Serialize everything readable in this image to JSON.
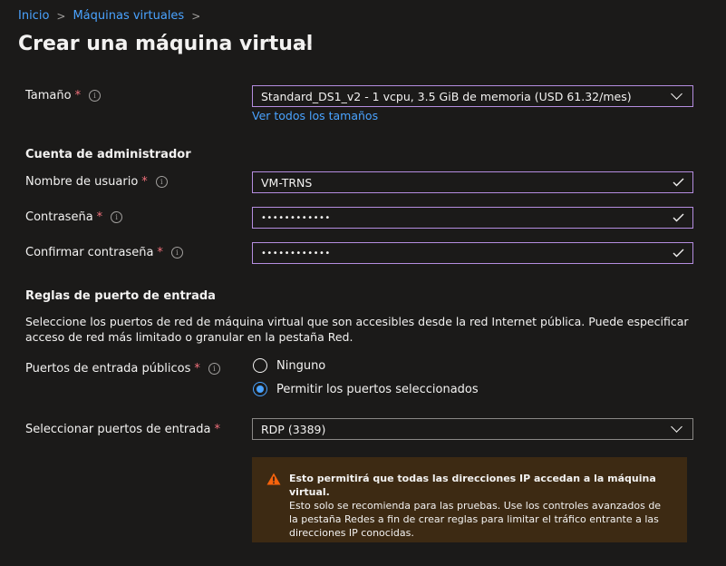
{
  "breadcrumb": {
    "items": [
      "Inicio",
      "Máquinas virtuales"
    ],
    "separator": ">"
  },
  "page": {
    "title": "Crear una máquina virtual",
    "more": "···"
  },
  "size": {
    "label": "Tamaño",
    "required": "*",
    "value": "Standard_DS1_v2 - 1 vcpu, 3.5 GiB de memoria (USD 61.32/mes)",
    "link": "Ver todos los tamaños"
  },
  "admin": {
    "heading": "Cuenta de administrador",
    "username_label": "Nombre de usuario",
    "username_value": "VM-TRNS",
    "password_label": "Contraseña",
    "password_value": "••••••••••••",
    "confirm_label": "Confirmar contraseña",
    "confirm_value": "••••••••••••",
    "required": "*"
  },
  "ports": {
    "heading": "Reglas de puerto de entrada",
    "description": "Seleccione los puertos de red de máquina virtual que son accesibles desde la red Internet pública. Puede especificar acceso de red más limitado o granular en la pestaña Red.",
    "public_label": "Puertos de entrada públicos",
    "options": [
      "Ninguno",
      "Permitir los puertos seleccionados"
    ],
    "selected_option": "Permitir los puertos seleccionados",
    "select_label": "Seleccionar puertos de entrada",
    "select_value": "RDP (3389)",
    "required": "*"
  },
  "warning": {
    "title": "Esto permitirá que todas las direcciones IP accedan a la máquina virtual.",
    "body": " Esto solo se recomienda para las pruebas.  Use los controles avanzados de la pestaña Redes a fin de crear reglas para limitar el tráfico entrante a las direcciones IP conocidas.",
    "icon": "warning-icon"
  },
  "colors": {
    "background": "#1b1a19",
    "accent": "#4aa3ff",
    "field_border_valid": "#b58de0",
    "required": "#f1707b",
    "warning_bg": "#3d2a13",
    "warning_icon": "#f7630c"
  }
}
